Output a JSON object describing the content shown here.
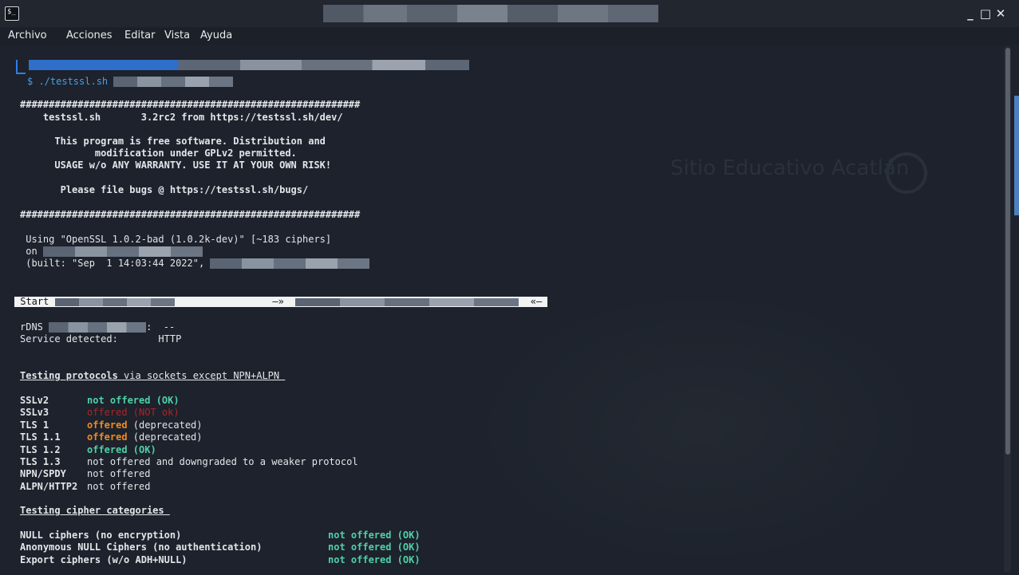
{
  "window": {
    "icon_glyph": "$_",
    "controls": {
      "minimize": "_",
      "maximize": "□",
      "close": "✕"
    }
  },
  "menu": [
    "Archivo",
    "Acciones",
    "Editar",
    "Vista",
    "Ayuda"
  ],
  "watermark": "Sitio Educativo Acatlán",
  "prompt": {
    "symbol": "$",
    "command": " ./testssl.sh"
  },
  "banner": {
    "hash_line": "###########################################################",
    "version_line": "    testssl.sh       3.2rc2 from https://testssl.sh/dev/",
    "license_1": "      This program is free software. Distribution and",
    "license_2": "             modification under GPLv2 permitted.",
    "license_3": "      USAGE w/o ANY WARRANTY. USE IT AT YOUR OWN RISK!",
    "bugs": "       Please file bugs @ https://testssl.sh/bugs/"
  },
  "openssl": {
    "using": " Using \"OpenSSL 1.0.2-bad (1.0.2k-dev)\" [~183 ciphers]",
    "on": " on ",
    "built": " (built: \"Sep  1 14:03:44 2022\", "
  },
  "start_bar": {
    "start": " Start ",
    "arrow_right": "—»",
    "arrow_left": "«—"
  },
  "rdns": {
    "label": "rDNS ",
    "value": "  --"
  },
  "service": {
    "label": "Service detected:",
    "value": "HTTP"
  },
  "sections": {
    "protocols_title": "Testing protocols",
    "protocols_suffix": " via sockets except NPN+ALPN ",
    "ciphers_title": "Testing cipher categories "
  },
  "protocols": [
    {
      "name": "SSLv2",
      "status": "not offered (OK)",
      "extra": "",
      "cls": "green"
    },
    {
      "name": "SSLv3",
      "status": "offered (NOT ok)",
      "extra": "",
      "cls": "red"
    },
    {
      "name": "TLS 1",
      "status": "offered",
      "extra": " (deprecated)",
      "cls": "orange"
    },
    {
      "name": "TLS 1.1",
      "status": "offered",
      "extra": " (deprecated)",
      "cls": "orange"
    },
    {
      "name": "TLS 1.2",
      "status": "offered (OK)",
      "extra": "",
      "cls": "green"
    },
    {
      "name": "TLS 1.3",
      "status": "not offered and downgraded to a weaker protocol",
      "extra": "",
      "cls": "plain"
    },
    {
      "name": "NPN/SPDY",
      "status": "not offered",
      "extra": "",
      "cls": "plain"
    },
    {
      "name": "ALPN/HTTP2",
      "status": "not offered",
      "extra": "",
      "cls": "plain"
    }
  ],
  "ciphers": [
    {
      "name": "NULL ciphers (no encryption)",
      "status": "not offered (OK)"
    },
    {
      "name": "Anonymous NULL Ciphers (no authentication)",
      "status": "not offered (OK)"
    },
    {
      "name": "Export ciphers (w/o ADH+NULL)",
      "status": "not offered (OK)"
    }
  ],
  "colors": {
    "green": "#4fd1a8",
    "red": "#a8262a",
    "orange": "#f08a1f",
    "prompt": "#2f7fe3",
    "background": "#1d222c"
  }
}
